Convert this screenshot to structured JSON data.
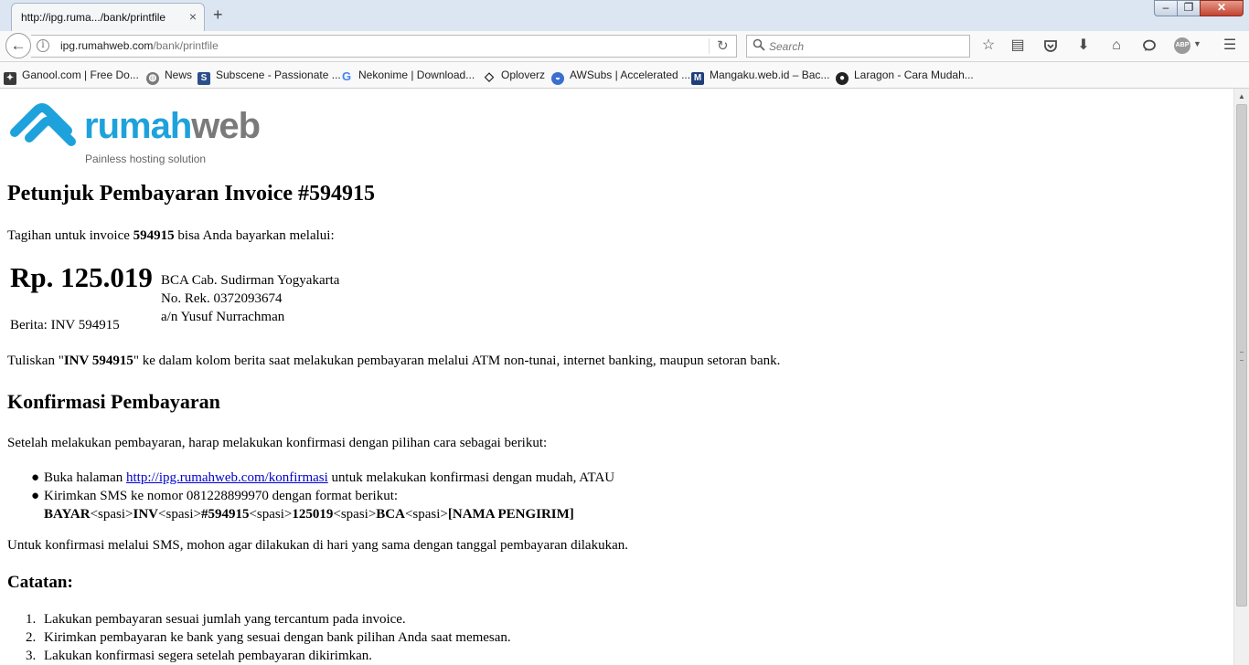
{
  "browser": {
    "tab_title": "http://ipg.ruma.../bank/printfile",
    "tab_close": "×",
    "new_tab": "+",
    "window_minimize": "–",
    "window_maximize": "❐",
    "window_close": "✕",
    "url_domain": "ipg.rumahweb.com",
    "url_path": "/bank/printfile",
    "search_placeholder": "Search",
    "abp_label": "ABP",
    "bookmarks": [
      {
        "label": "Ganool.com | Free Do...",
        "icon": "ganool-icon",
        "color": "#3a3a3a"
      },
      {
        "label": "News",
        "icon": "globe-icon",
        "color": "#7a7a7a"
      },
      {
        "label": "Subscene - Passionate ...",
        "icon": "subscene-icon",
        "color": "#2b4f8a"
      },
      {
        "label": "Nekonime | Download...",
        "icon": "google-icon",
        "color": "#ffffff"
      },
      {
        "label": "Oploverz",
        "icon": "diamond-icon",
        "color": "#ffffff"
      },
      {
        "label": "AWSubs | Accelerated ...",
        "icon": "awsubs-icon",
        "color": "#3b6fcf"
      },
      {
        "label": "Mangaku.web.id – Bac...",
        "icon": "mangaku-icon",
        "color": "#1e3f7a"
      },
      {
        "label": "Laragon - Cara Mudah...",
        "icon": "laragon-icon",
        "color": "#222222"
      }
    ]
  },
  "page": {
    "logo_rumah": "rumah",
    "logo_web": "web",
    "logo_tagline": "Painless hosting solution",
    "title": "Petunjuk Pembayaran Invoice #594915",
    "intro_before": "Tagihan untuk invoice ",
    "intro_invoice": "594915",
    "intro_after": " bisa Anda bayarkan melalui:",
    "amount": "Rp. 125.019",
    "bank_name": "BCA Cab. Sudirman Yogyakarta",
    "account_number": "No. Rek. 0372093674",
    "account_holder": "a/n Yusuf Nurrachman",
    "berita": "Berita: INV 594915",
    "instruction_before": "Tuliskan \"",
    "instruction_code": "INV 594915",
    "instruction_after": "\" ke dalam kolom berita saat melakukan pembayaran melalui ATM non-tunai, internet banking, maupun setoran bank.",
    "confirm_title": "Konfirmasi Pembayaran",
    "confirm_intro": "Setelah melakukan pembayaran, harap melakukan konfirmasi dengan pilihan cara sebagai berikut:",
    "confirm_item1_before": "Buka halaman ",
    "confirm_item1_link": "http://ipg.rumahweb.com/konfirmasi",
    "confirm_item1_after": " untuk melakukan konfirmasi dengan mudah, ATAU",
    "confirm_item2_line1": "Kirimkan SMS ke nomor 081228899970 dengan format berikut:",
    "sms_format": {
      "bayar": "BAYAR",
      "sep": "<spasi>",
      "inv": "INV",
      "num": "#594915",
      "amount": "125019",
      "bank": "BCA",
      "name": "[NAMA PENGIRIM]"
    },
    "sms_note": "Untuk konfirmasi melalui SMS, mohon agar dilakukan di hari yang sama dengan tanggal pembayaran dilakukan.",
    "notes_title": "Catatan:",
    "notes": [
      "Lakukan pembayaran sesuai jumlah yang tercantum pada invoice.",
      "Kirimkan pembayaran ke bank yang sesuai dengan bank pilihan Anda saat memesan.",
      "Lakukan konfirmasi segera setelah pembayaran dikirimkan."
    ]
  }
}
